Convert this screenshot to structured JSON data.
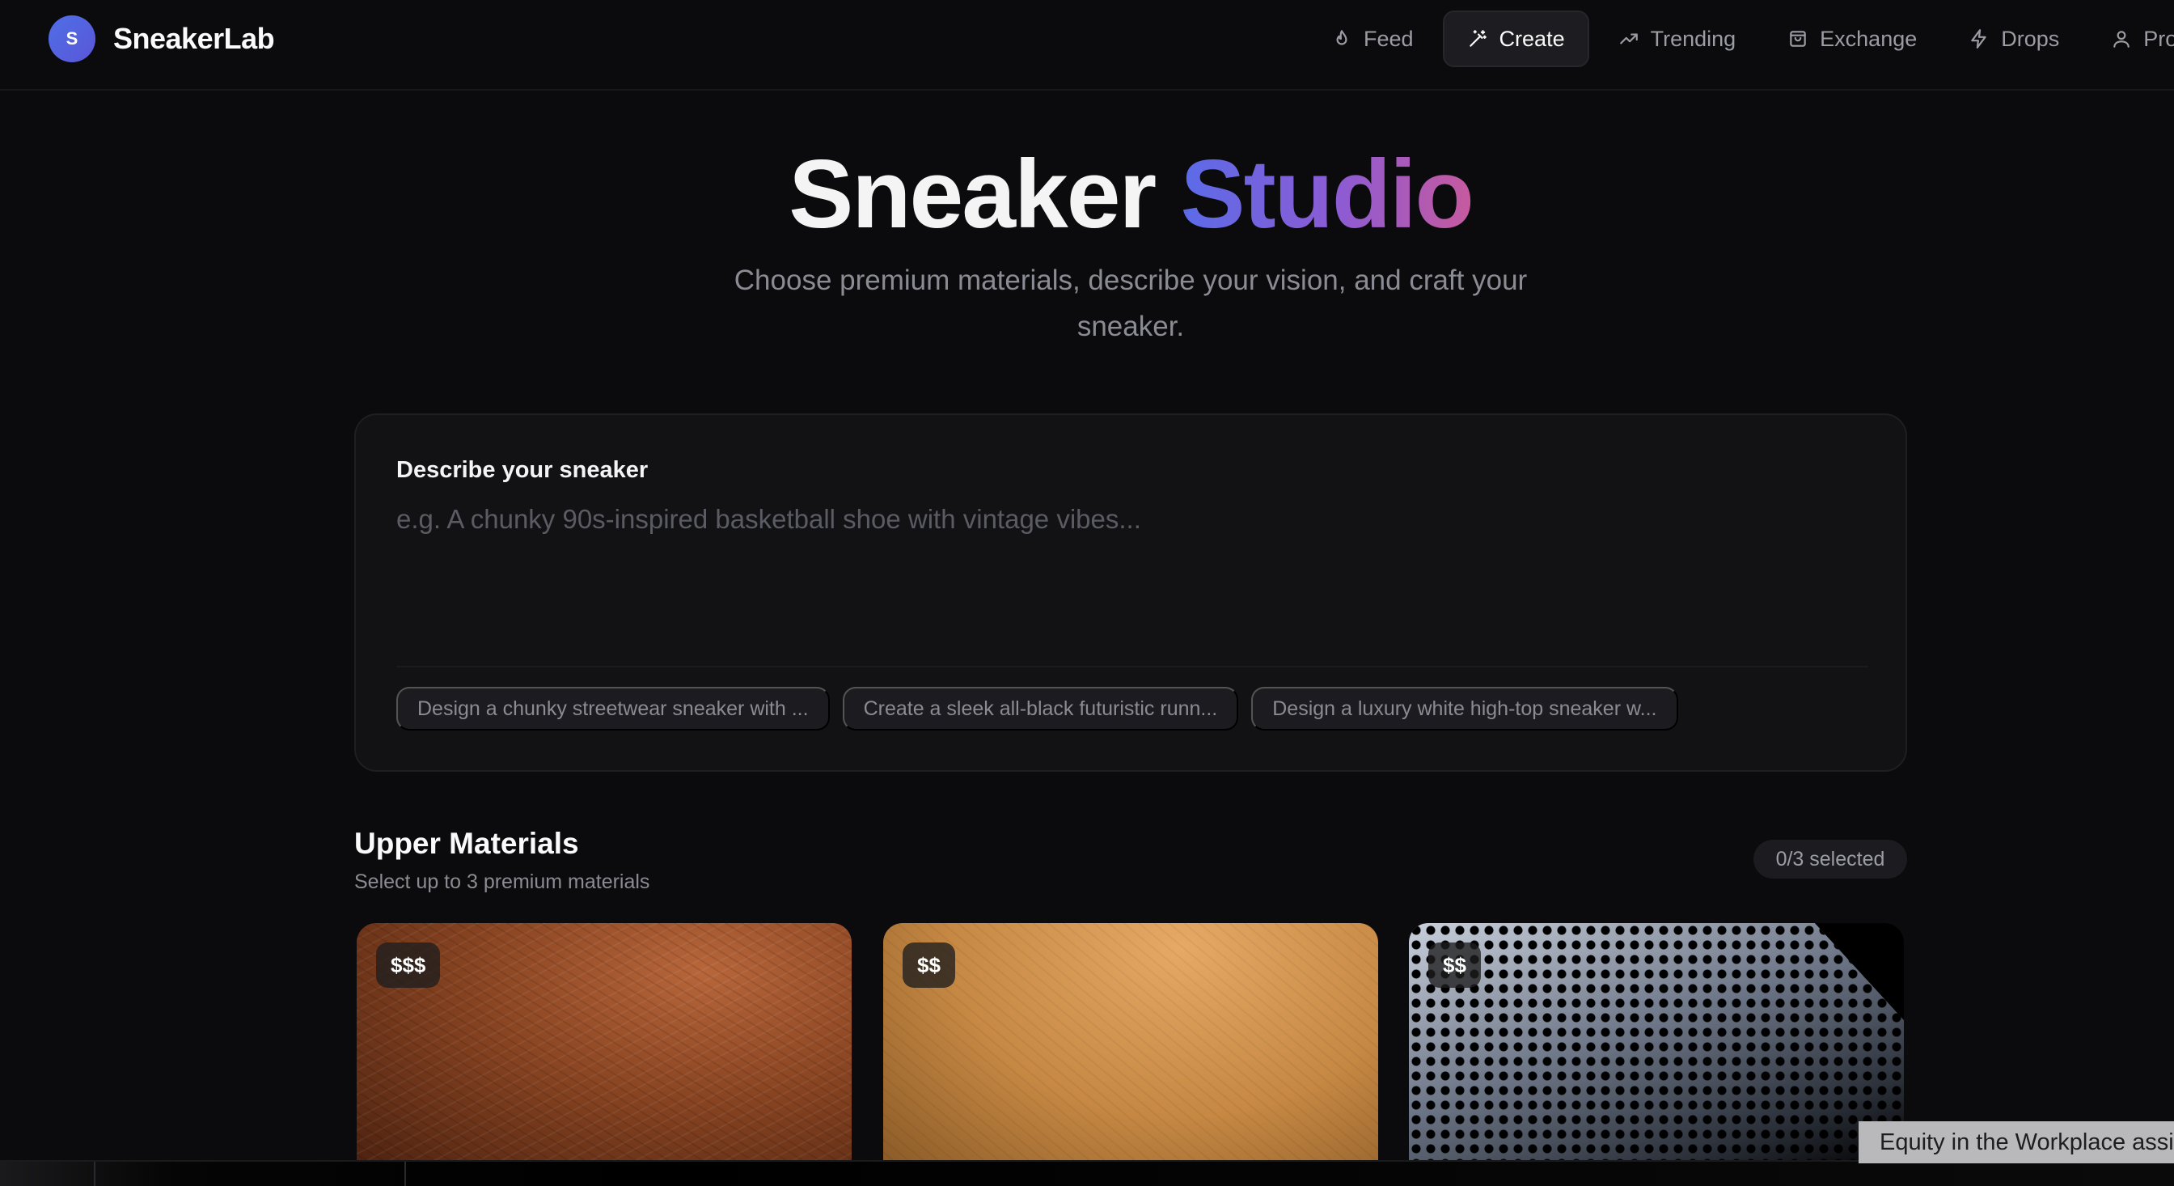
{
  "brand": {
    "initial": "S",
    "name": "SneakerLab"
  },
  "nav": {
    "items": [
      {
        "label": "Feed",
        "icon": "flame-icon",
        "active": false
      },
      {
        "label": "Create",
        "icon": "magic-wand-icon",
        "active": true
      },
      {
        "label": "Trending",
        "icon": "trending-up-icon",
        "active": false
      },
      {
        "label": "Exchange",
        "icon": "shopping-bag-icon",
        "active": false
      },
      {
        "label": "Drops",
        "icon": "lightning-icon",
        "active": false
      },
      {
        "label": "Profile",
        "icon": "user-icon",
        "active": false
      }
    ]
  },
  "hero": {
    "title_main": "Sneaker",
    "title_accent": "Studio",
    "subtitle": "Choose premium materials, describe your vision, and craft your sneaker."
  },
  "describe": {
    "label": "Describe your sneaker",
    "placeholder": "e.g. A chunky 90s-inspired basketball shoe with vintage vibes...",
    "value": "",
    "suggestions": [
      "Design a chunky streetwear sneaker with ...",
      "Create a sleek all-black futuristic runn...",
      "Design a luxury white high-top sneaker w..."
    ]
  },
  "materials": {
    "title": "Upper Materials",
    "subtitle": "Select up to 3 premium materials",
    "selected_badge": "0/3 selected",
    "cards": [
      {
        "price": "$$$"
      },
      {
        "price": "$$"
      },
      {
        "price": "$$"
      }
    ]
  },
  "toast": {
    "text": "Equity in the Workplace assi"
  },
  "colors": {
    "background": "#0b0b0d",
    "accent_gradient_start": "#5b6be8",
    "accent_gradient_end": "#c75a9e",
    "brand_mark": "#4f6fe6"
  }
}
